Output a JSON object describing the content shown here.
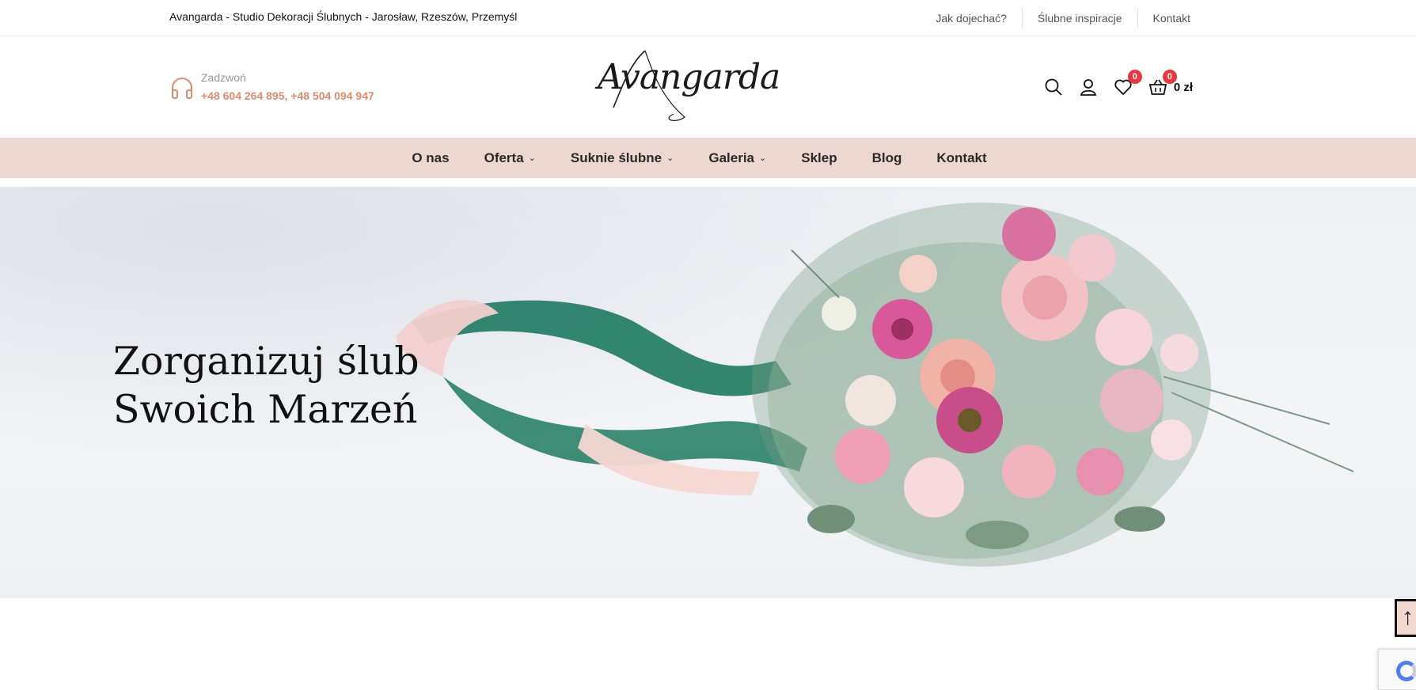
{
  "topbar": {
    "tagline": "Avangarda - Studio Dekoracji Ślubnych - Jarosław, Rzeszów, Przemyśl",
    "links": [
      "Jak dojechać?",
      "Ślubne inspiracje",
      "Kontakt"
    ]
  },
  "header": {
    "call_label": "Zadzwoń",
    "phones": "+48 604 264 895, +48 504 094 947",
    "logo_text": "Avangarda",
    "wishlist_count": "0",
    "cart_count": "0",
    "cart_total": "0 zł"
  },
  "nav": {
    "items": [
      {
        "label": "O nas"
      },
      {
        "label": "Oferta"
      },
      {
        "label": "Suknie ślubne"
      },
      {
        "label": "Galeria"
      },
      {
        "label": "Sklep"
      },
      {
        "label": "Blog"
      },
      {
        "label": "Kontakt"
      }
    ]
  },
  "hero": {
    "title_line1": "Zorganizuj ślub",
    "title_line2": "Swoich Marzeń"
  },
  "colors": {
    "accent": "#e08a6e",
    "nav_bg": "#ecd8d1",
    "badge": "#e8383d"
  },
  "icons": [
    "headphones-icon",
    "search-icon",
    "user-icon",
    "heart-icon",
    "basket-icon",
    "arrow-up-icon"
  ]
}
